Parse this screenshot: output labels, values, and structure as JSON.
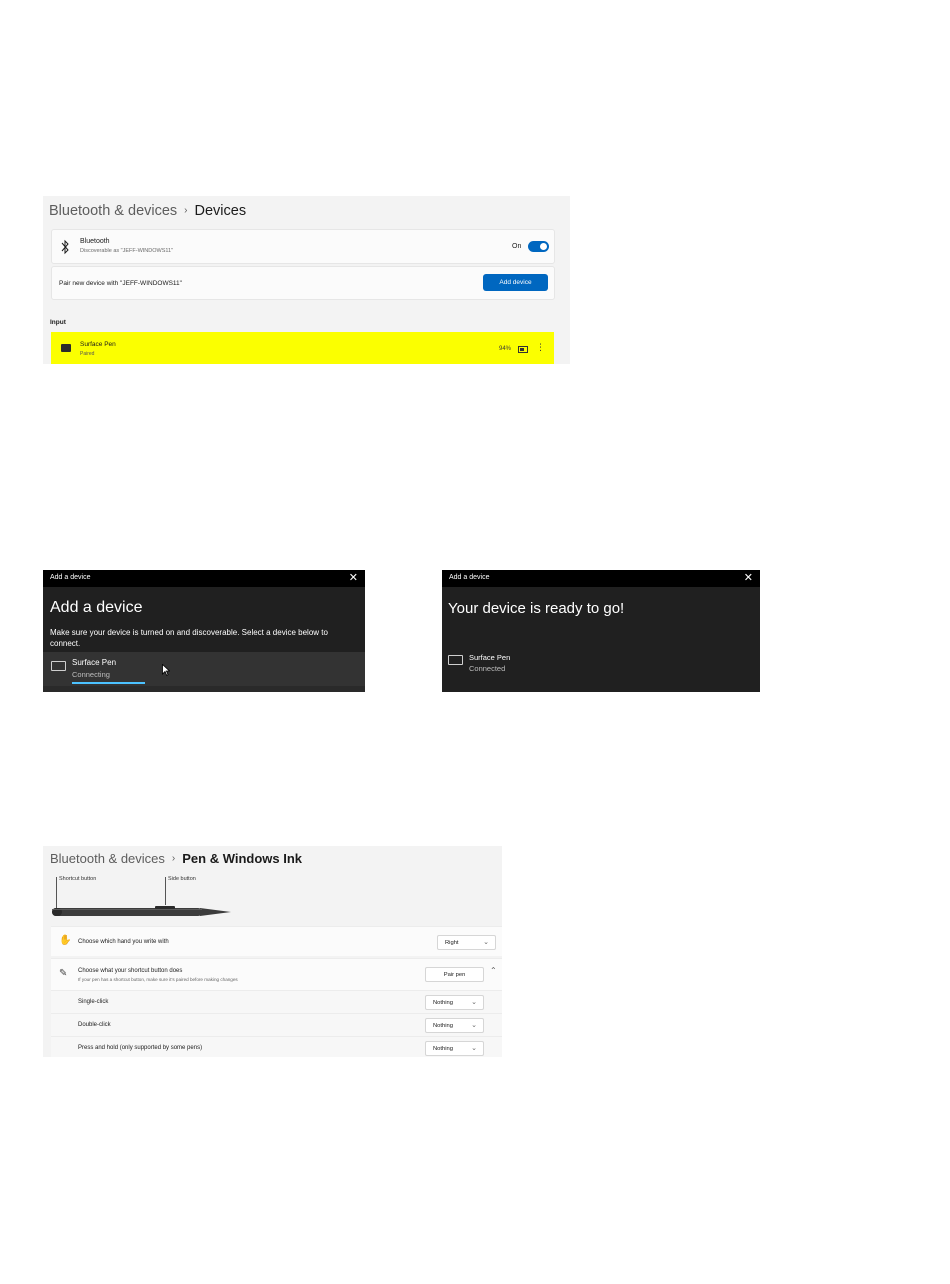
{
  "panel_devices": {
    "breadcrumb_parent": "Bluetooth & devices",
    "breadcrumb_separator": "›",
    "breadcrumb_current": "Devices",
    "bluetooth": {
      "title": "Bluetooth",
      "subtitle": "Discoverable as \"JEFF-WINDOWS11\"",
      "state_label": "On",
      "toggle_on": true,
      "icon": "bluetooth-icon"
    },
    "pair": {
      "label": "Pair new device with \"JEFF-WINDOWS11\"",
      "button": "Add device"
    },
    "section_label": "Input",
    "device": {
      "name": "Surface Pen",
      "status": "Paired",
      "battery": "94%",
      "icon": "pen-icon",
      "highlight_color": "#fbff00"
    }
  },
  "dialog_connecting": {
    "window_title": "Add a device",
    "close_glyph": "✕",
    "heading": "Add a device",
    "description": "Make sure your device is turned on and discoverable. Select a device below to connect.",
    "device_name": "Surface Pen",
    "device_status": "Connecting"
  },
  "dialog_ready": {
    "window_title": "Add a device",
    "close_glyph": "✕",
    "heading": "Your device is ready to go!",
    "device_name": "Surface Pen",
    "device_status": "Connected"
  },
  "panel_pen": {
    "breadcrumb_parent": "Bluetooth & devices",
    "breadcrumb_separator": "›",
    "breadcrumb_current": "Pen & Windows Ink",
    "callout_shortcut": "Shortcut button",
    "callout_side": "Side button",
    "rows": {
      "hand": {
        "label": "Choose which hand you write with",
        "value": "Right"
      },
      "shortcut": {
        "label": "Choose what your shortcut button does",
        "sub": "If your pen has a shortcut button, make sure it's paired before making changes",
        "button": "Pair pen"
      },
      "single": {
        "label": "Single-click",
        "value": "Nothing"
      },
      "double": {
        "label": "Double-click",
        "value": "Nothing"
      },
      "hold": {
        "label": "Press and hold (only supported by some pens)",
        "value": "Nothing"
      }
    }
  },
  "colors": {
    "accent": "#0067c0",
    "progress": "#4cc2ff",
    "dialog_bg": "#202020"
  }
}
